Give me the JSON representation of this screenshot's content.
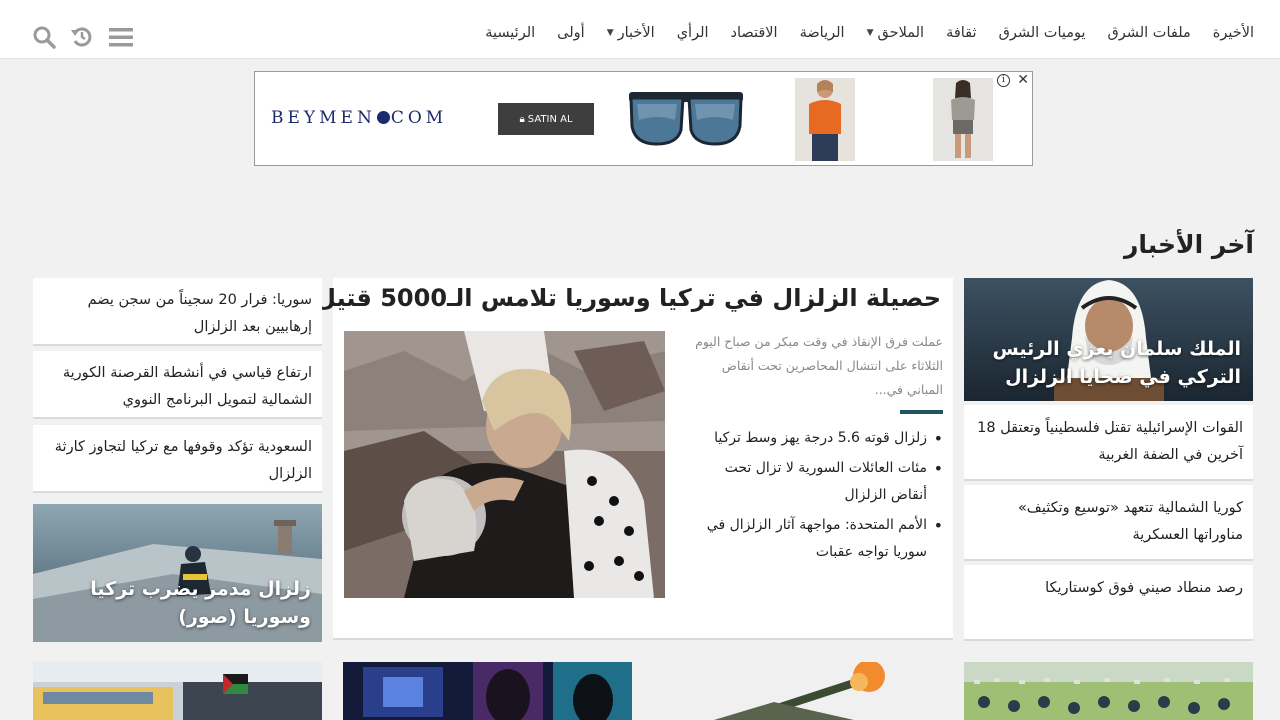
{
  "nav": {
    "items": [
      {
        "label": "الرئيسية",
        "has_dropdown": false
      },
      {
        "label": "أولى",
        "has_dropdown": false
      },
      {
        "label": "الأخبار",
        "has_dropdown": true
      },
      {
        "label": "الرأي",
        "has_dropdown": false
      },
      {
        "label": "الاقتصاد",
        "has_dropdown": false
      },
      {
        "label": "الرياضة",
        "has_dropdown": false
      },
      {
        "label": "الملاحق",
        "has_dropdown": true
      },
      {
        "label": "ثقافة",
        "has_dropdown": false
      },
      {
        "label": "يوميات الشرق",
        "has_dropdown": false
      },
      {
        "label": "ملفات الشرق",
        "has_dropdown": false
      },
      {
        "label": "الأخيرة",
        "has_dropdown": false
      }
    ],
    "icons": [
      "search-icon",
      "history-icon",
      "menu-icon"
    ],
    "icon_color": "#9a9a9a"
  },
  "ad": {
    "brand_left": "BEYMEN",
    "brand_right": "COM",
    "button_label": "SATIN AL",
    "info_label": "i",
    "close_label": "✕"
  },
  "section_title": "آخر الأخبار",
  "right_column": {
    "feature_caption": "الملك سلمان يعزي الرئيس التركي في ضحايا الزلزال",
    "cards": [
      "القوات الإسرائيلية تقتل فلسطينياً وتعتقل 18 آخرين في الضفة الغربية",
      "كوريا الشمالية تتعهد «توسيع وتكثيف» مناوراتها العسكرية",
      "رصد منطاد صيني فوق كوستاريكا"
    ]
  },
  "main_story": {
    "title": "حصيلة الزلزال في تركيا وسوريا تلامس الـ5000 قتيل",
    "excerpt": "عملت فرق الإنقاذ في وقت مبكر من صباح اليوم الثلاثاء على انتشال المحاصرين تحت أنقاض المباني في...",
    "related": [
      "زلزال قوته 5.6 درجة يهز وسط تركيا",
      "مئات العائلات السورية لا تزال تحت أنقاض الزلزال",
      "الأمم المتحدة: مواجهة آثار الزلزال في سوريا تواجه عقبات"
    ]
  },
  "left_column": {
    "cards": [
      "سوريا: فرار 20 سجيناً من سجن يضم إرهابيين بعد الزلزال",
      "ارتفاع قياسي في أنشطة القرصنة الكورية الشمالية لتمويل البرنامج النووي",
      "السعودية تؤكد وقوفها مع تركيا لتجاوز كارثة الزلزال"
    ],
    "feature_caption": "زلزال مدمر يضرب تركيا وسوريا (صور)"
  },
  "colors": {
    "accent_divider": "#1f5460",
    "page_bg": "#f1f1f1"
  }
}
